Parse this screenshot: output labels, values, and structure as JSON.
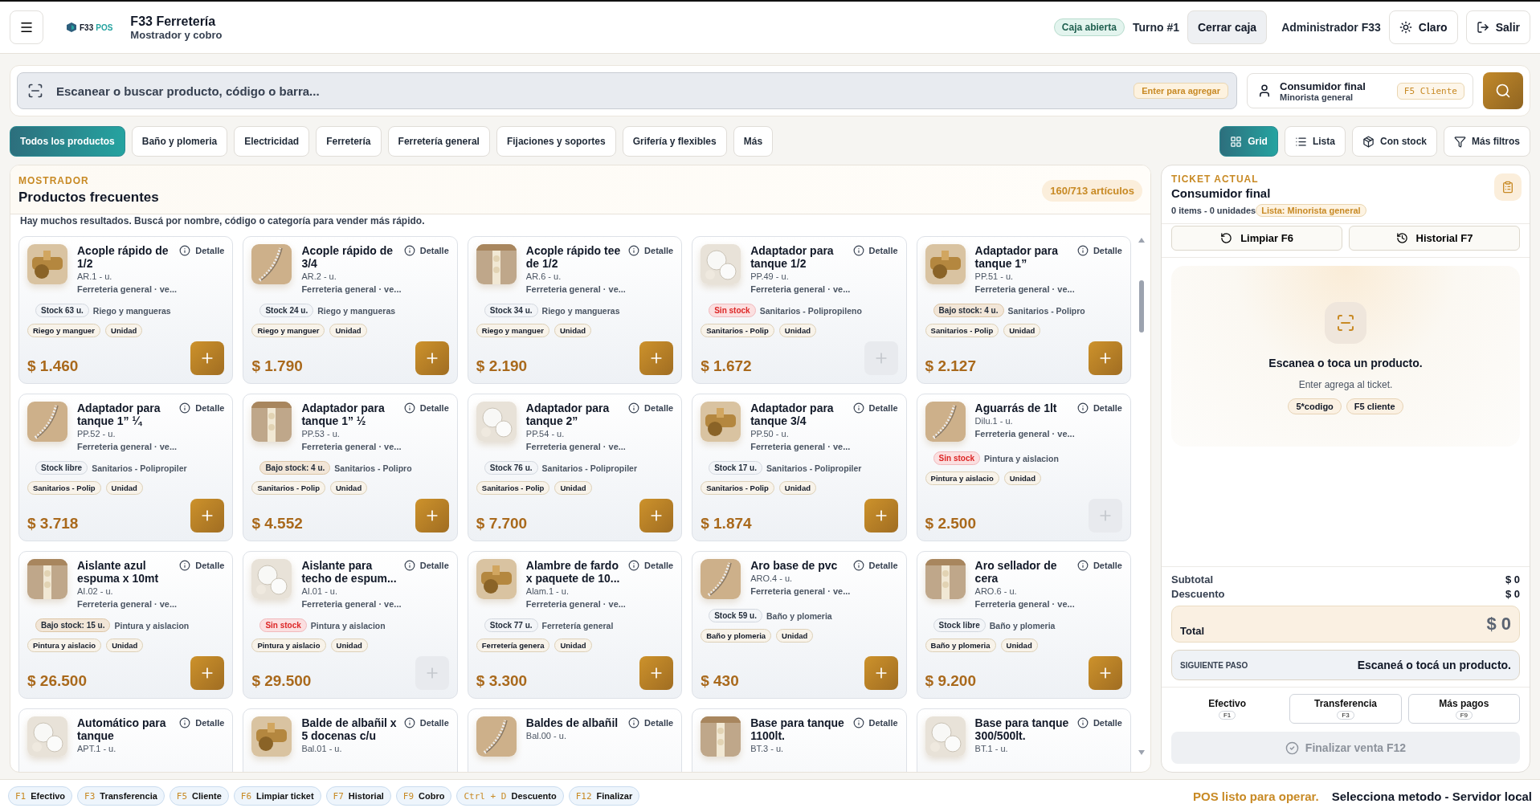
{
  "header": {
    "logo_text": "F33",
    "logo_suffix": "POS",
    "title": "F33 Ferretería",
    "subtitle": "Mostrador y cobro",
    "status_badge": "Caja abierta",
    "shift": "Turno #1",
    "close_button": "Cerrar caja",
    "user": "Administrador F33",
    "theme_button": "Claro",
    "exit_button": "Salir"
  },
  "search": {
    "placeholder": "Escanear o buscar producto, código o barra...",
    "hint": "Enter para agregar",
    "customer_name": "Consumidor final",
    "customer_list": "Minorista general",
    "customer_key": "F5 Cliente"
  },
  "categories": [
    {
      "label": "Todos los productos",
      "selected": true
    },
    {
      "label": "Baño y plomeria",
      "selected": false
    },
    {
      "label": "Electricidad",
      "selected": false
    },
    {
      "label": "Ferretería",
      "selected": false
    },
    {
      "label": "Ferretería general",
      "selected": false
    },
    {
      "label": "Fijaciones y soportes",
      "selected": false
    },
    {
      "label": "Grifería y flexibles",
      "selected": false
    },
    {
      "label": "Más",
      "selected": false
    }
  ],
  "views": [
    {
      "label": "Grid",
      "kind": "grid",
      "selected": true
    },
    {
      "label": "Lista",
      "kind": "list",
      "selected": false
    },
    {
      "label": "Con stock",
      "kind": "stock",
      "selected": false
    },
    {
      "label": "Más filtros",
      "kind": "filter",
      "selected": false
    }
  ],
  "catalog": {
    "eyebrow": "MOSTRADOR",
    "title": "Productos frecuentes",
    "count": "160/713 artículos",
    "notice": "Hay muchos resultados. Buscá por nombre, código o categoría para vender más rápido.",
    "products": [
      {
        "name": "Acople rápido de 1/2",
        "detail": "Detalle",
        "code": "AR.1 - u.",
        "category": "Ferreteria general · ve...",
        "stock": "Stock 63 u.",
        "kind": "in_stock",
        "group": "Riego y mangueras",
        "tag": "Riego y manguer",
        "unit": "Unidad",
        "price": "$ 1.460"
      },
      {
        "name": "Acople rápido de 3/4",
        "detail": "Detalle",
        "code": "AR.2 - u.",
        "category": "Ferreteria general · ve...",
        "stock": "Stock 24 u.",
        "kind": "in_stock",
        "group": "Riego y mangueras",
        "tag": "Riego y manguer",
        "unit": "Unidad",
        "price": "$ 1.790"
      },
      {
        "name": "Acople rápido tee de 1/2",
        "detail": "Detalle",
        "code": "AR.6 - u.",
        "category": "Ferreteria general · ve...",
        "stock": "Stock 34 u.",
        "kind": "in_stock",
        "group": "Riego y mangueras",
        "tag": "Riego y manguer",
        "unit": "Unidad",
        "price": "$ 2.190"
      },
      {
        "name": "Adaptador para tanque 1/2",
        "detail": "Detalle",
        "code": "PP.49 - u.",
        "category": "Ferreteria general · ve...",
        "stock": "Sin stock",
        "kind": "out_of_stock",
        "group": "Sanitarios - Polipropileno",
        "tag": "Sanitarios - Polip",
        "unit": "Unidad",
        "price": "$ 1.672"
      },
      {
        "name": "Adaptador para tanque 1”",
        "detail": "Detalle",
        "code": "PP.51 - u.",
        "category": "Ferreteria general · ve...",
        "stock": "Bajo stock: 4 u.",
        "kind": "low_stock",
        "group": "Sanitarios - Polipro",
        "tag": "Sanitarios - Polip",
        "unit": "Unidad",
        "price": "$ 2.127"
      },
      {
        "name": "Adaptador para tanque 1” ¼",
        "detail": "Detalle",
        "code": "PP.52 - u.",
        "category": "Ferreteria general · ve...",
        "stock": "Stock libre",
        "kind": "in_stock",
        "group": "Sanitarios - Polipropiler",
        "tag": "Sanitarios - Polip",
        "unit": "Unidad",
        "price": "$ 3.718"
      },
      {
        "name": "Adaptador para tanque 1” ½",
        "detail": "Detalle",
        "code": "PP.53 - u.",
        "category": "Ferreteria general · ve...",
        "stock": "Bajo stock: 4 u.",
        "kind": "low_stock",
        "group": "Sanitarios - Polipro",
        "tag": "Sanitarios - Polip",
        "unit": "Unidad",
        "price": "$ 4.552"
      },
      {
        "name": "Adaptador para tanque 2”",
        "detail": "Detalle",
        "code": "PP.54 - u.",
        "category": "Ferreteria general · ve...",
        "stock": "Stock 76 u.",
        "kind": "in_stock",
        "group": "Sanitarios - Polipropiler",
        "tag": "Sanitarios - Polip",
        "unit": "Unidad",
        "price": "$ 7.700"
      },
      {
        "name": "Adaptador para tanque 3/4",
        "detail": "Detalle",
        "code": "PP.50 - u.",
        "category": "Ferreteria general · ve...",
        "stock": "Stock 17 u.",
        "kind": "in_stock",
        "group": "Sanitarios - Polipropiler",
        "tag": "Sanitarios - Polip",
        "unit": "Unidad",
        "price": "$ 1.874"
      },
      {
        "name": "Aguarrás de 1lt",
        "detail": "Detalle",
        "code": "Dilu.1 - u.",
        "category": "Ferreteria general · ve...",
        "stock": "Sin stock",
        "kind": "out_of_stock",
        "group": "Pintura y aislacion",
        "tag": "Pintura y aislacio",
        "unit": "Unidad",
        "price": "$ 2.500"
      },
      {
        "name": "Aislante azul espuma x 10mt",
        "detail": "Detalle",
        "code": "AI.02 - u.",
        "category": "Ferreteria general · ve...",
        "stock": "Bajo stock: 15 u.",
        "kind": "low_stock",
        "group": "Pintura y aislacion",
        "tag": "Pintura y aislacio",
        "unit": "Unidad",
        "price": "$ 26.500"
      },
      {
        "name": "Aislante para techo de espum...",
        "detail": "Detalle",
        "code": "AI.01 - u.",
        "category": "Ferreteria general · ve...",
        "stock": "Sin stock",
        "kind": "out_of_stock",
        "group": "Pintura y aislacion",
        "tag": "Pintura y aislacio",
        "unit": "Unidad",
        "price": "$ 29.500"
      },
      {
        "name": "Alambre de fardo x paquete de 10...",
        "detail": "Detalle",
        "code": "Alam.1 - u.",
        "category": "Ferreteria general · ve...",
        "stock": "Stock 77 u.",
        "kind": "in_stock",
        "group": "Ferretería general",
        "tag": "Ferretería genera",
        "unit": "Unidad",
        "price": "$ 3.300"
      },
      {
        "name": "Aro base de pvc",
        "detail": "Detalle",
        "code": "ARO.4 - u.",
        "category": "Ferreteria general · ve...",
        "stock": "Stock 59 u.",
        "kind": "in_stock",
        "group": "Baño y plomeria",
        "tag": "Baño y plomeria",
        "unit": "Unidad",
        "price": "$ 430"
      },
      {
        "name": "Aro sellador de cera",
        "detail": "Detalle",
        "code": "ARO.6 - u.",
        "category": "Ferreteria general · ve...",
        "stock": "Stock libre",
        "kind": "in_stock",
        "group": "Baño y plomeria",
        "tag": "Baño y plomeria",
        "unit": "Unidad",
        "price": "$ 9.200"
      },
      {
        "name": "Automático para tanque",
        "detail": "Detalle",
        "code": "APT.1 - u."
      },
      {
        "name": "Balde de albañil x 5 docenas c/u",
        "detail": "Detalle",
        "code": "Bal.01 - u."
      },
      {
        "name": "Baldes de albañil",
        "detail": "Detalle",
        "code": "Bal.00 - u."
      },
      {
        "name": "Base para tanque 1100lt.",
        "detail": "Detalle",
        "code": "BT.3 - u."
      },
      {
        "name": "Base para tanque 300/500lt.",
        "detail": "Detalle",
        "code": "BT.1 - u."
      }
    ]
  },
  "ticket": {
    "eyebrow": "TICKET ACTUAL",
    "customer": "Consumidor final",
    "summary": "0 items - 0 unidades",
    "price_list": "Lista: Minorista general",
    "clear_button": "Limpiar F6",
    "history_button": "Historial F7",
    "empty_title": "Escanea o toca un producto.",
    "empty_hint": "Enter agrega al ticket.",
    "empty_chips": [
      "5*codigo",
      "F5 cliente"
    ],
    "subtotal_label": "Subtotal",
    "subtotal": "$ 0",
    "discount_label": "Descuento",
    "discount": "$ 0",
    "total_label": "Total",
    "total": "$ 0",
    "next_label": "SIGUIENTE PASO",
    "next_text": "Escaneá o tocá un producto.",
    "payments": [
      {
        "label": "Efectivo",
        "key": "F1",
        "selected": true
      },
      {
        "label": "Transferencia",
        "key": "F3",
        "selected": false
      },
      {
        "label": "Más pagos",
        "key": "F9",
        "selected": false
      }
    ],
    "finish_button": "Finalizar venta F12",
    "finish_disabled": true
  },
  "shortcuts": [
    {
      "key": "F1",
      "label": "Efectivo"
    },
    {
      "key": "F3",
      "label": "Transferencia"
    },
    {
      "key": "F5",
      "label": "Cliente"
    },
    {
      "key": "F6",
      "label": "Limpiar ticket"
    },
    {
      "key": "F7",
      "label": "Historial"
    },
    {
      "key": "F9",
      "label": "Cobro"
    },
    {
      "key": "Ctrl + D",
      "label": "Descuento"
    },
    {
      "key": "F12",
      "label": "Finalizar"
    }
  ],
  "status_bar": {
    "ready": "POS listo para operar.",
    "message": "Selecciona metodo - Servidor local"
  }
}
